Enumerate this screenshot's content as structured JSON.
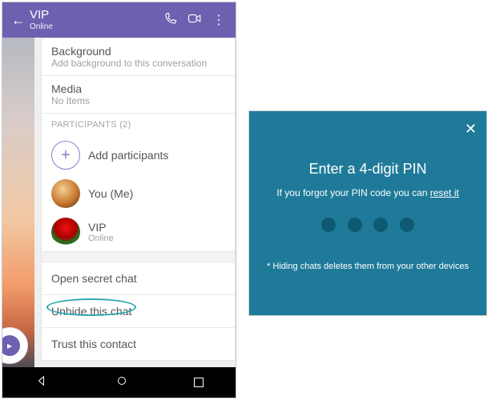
{
  "header": {
    "title": "VIP",
    "subtitle": "Online"
  },
  "settings": {
    "background": {
      "title": "Background",
      "sub": "Add background to this conversation"
    },
    "media": {
      "title": "Media",
      "sub": "No Items"
    },
    "participants_header": "PARTICIPANTS (2)",
    "add_participants": "Add participants",
    "you": {
      "name": "You (Me)"
    },
    "vip": {
      "name": "VIP",
      "sub": "Online"
    },
    "open_secret": "Open secret chat",
    "unhide": "Unhide this chat",
    "trust_contact": "Trust this contact"
  },
  "pin": {
    "title": "Enter a 4-digit PIN",
    "info_pre": "If you forgot your PIN code you can ",
    "reset": "reset it",
    "hint": "* Hiding chats deletes them from your other devices"
  }
}
